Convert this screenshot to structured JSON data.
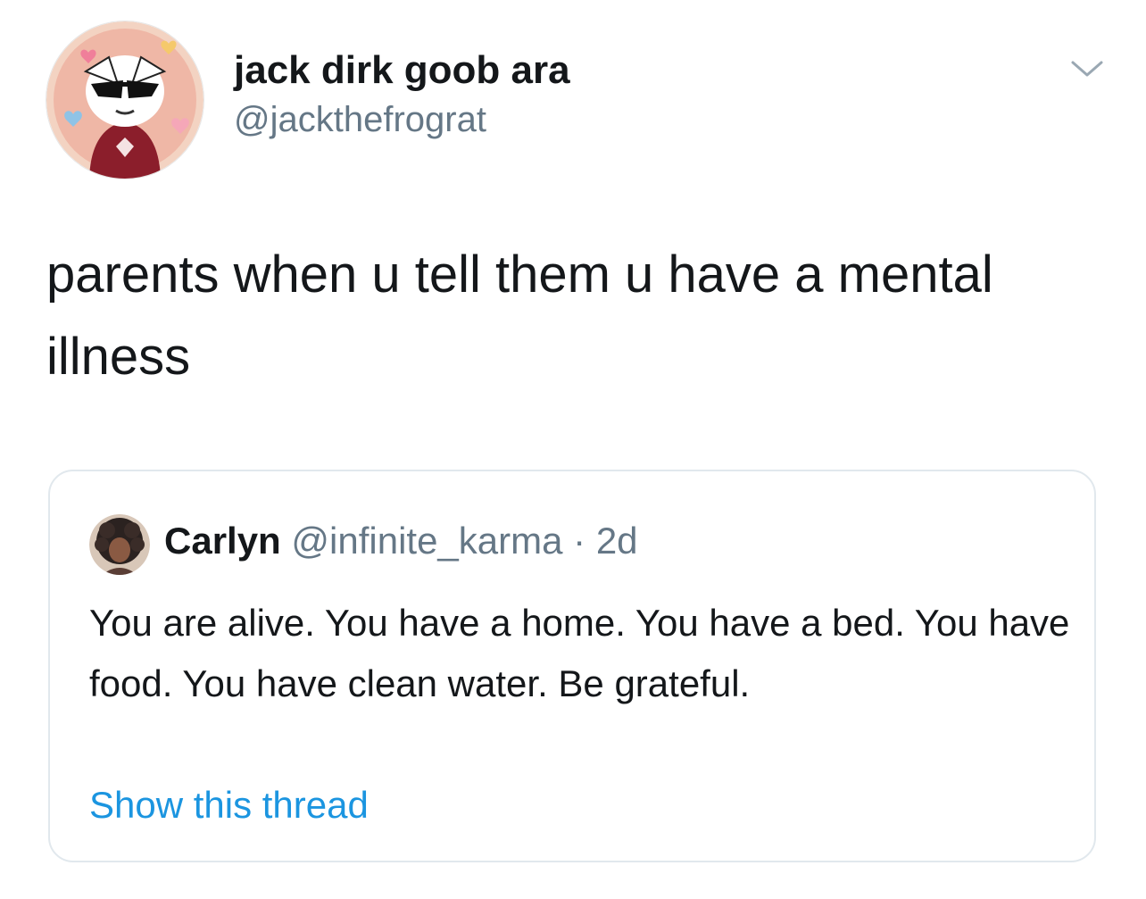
{
  "author": {
    "name": "jack dirk goob ara",
    "handle": "@jackthefrograt",
    "avatar_icon": "cartoon-character-avatar-icon"
  },
  "menu_icon": "chevron-down-icon",
  "tweet": {
    "text": "parents when u tell them u have a mental illness"
  },
  "quoted_tweet": {
    "name": "Carlyn",
    "handle": "@infinite_karma",
    "separator": "·",
    "time": "2d",
    "text": "You are alive. You have a home. You have a bed. You have food. You have clean water. Be grateful.",
    "avatar_icon": "user-photo-avatar-icon",
    "show_thread_label": "Show this thread"
  },
  "colors": {
    "text_primary": "#14171a",
    "text_secondary": "#657786",
    "link": "#1b95e0",
    "border": "#e1e8ed"
  }
}
